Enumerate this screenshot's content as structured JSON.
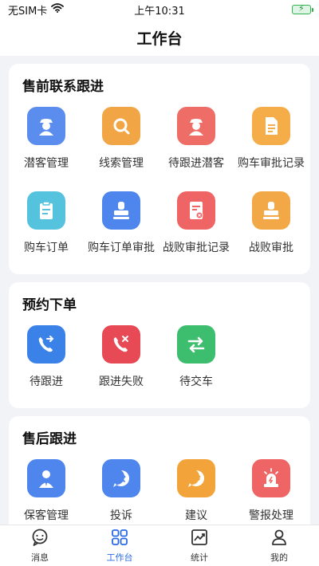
{
  "status_bar": {
    "carrier": "无SIM卡",
    "time": "上午10:31"
  },
  "nav": {
    "title": "工作台"
  },
  "sections": [
    {
      "title": "售前联系跟进",
      "items": [
        {
          "label": "潜客管理",
          "icon": "user-hat-icon",
          "color": "#5b8def"
        },
        {
          "label": "线索管理",
          "icon": "magnifier-icon",
          "color": "#f2a545"
        },
        {
          "label": "待跟进潜客",
          "icon": "user-hat-icon",
          "color": "#ef6d67"
        },
        {
          "label": "购车审批记录",
          "icon": "document-icon",
          "color": "#f4ad48"
        },
        {
          "label": "购车订单",
          "icon": "clipboard-icon",
          "color": "#55c3de"
        },
        {
          "label": "购车订单审批",
          "icon": "stamp-icon",
          "color": "#4f86ee"
        },
        {
          "label": "战败审批记录",
          "icon": "document-x-icon",
          "color": "#ef6464"
        },
        {
          "label": "战败审批",
          "icon": "stamp-icon",
          "color": "#f3a848"
        }
      ]
    },
    {
      "title": "预约下单",
      "items": [
        {
          "label": "待跟进",
          "icon": "phone-forward-icon",
          "color": "#3b82e8"
        },
        {
          "label": "跟进失败",
          "icon": "phone-x-icon",
          "color": "#e84a55"
        },
        {
          "label": "待交车",
          "icon": "swap-arrows-icon",
          "color": "#3dbd6e"
        }
      ]
    },
    {
      "title": "售后跟进",
      "items": [
        {
          "label": "保客管理",
          "icon": "user-tie-icon",
          "color": "#4f86ee"
        },
        {
          "label": "投诉",
          "icon": "frown-bubble-icon",
          "color": "#4f86ee"
        },
        {
          "label": "建议",
          "icon": "smile-bubble-icon",
          "color": "#f2a43a"
        },
        {
          "label": "警报处理",
          "icon": "alarm-icon",
          "color": "#ef6464"
        }
      ]
    }
  ],
  "tabs": [
    {
      "label": "消息",
      "icon": "chat-icon",
      "active": false
    },
    {
      "label": "工作台",
      "icon": "grid-icon",
      "active": true
    },
    {
      "label": "统计",
      "icon": "trend-chart-icon",
      "active": false
    },
    {
      "label": "我的",
      "icon": "person-icon",
      "active": false
    }
  ],
  "colors": {
    "accent": "#2b6ae6",
    "background": "#f2f3f7",
    "card": "#ffffff"
  }
}
